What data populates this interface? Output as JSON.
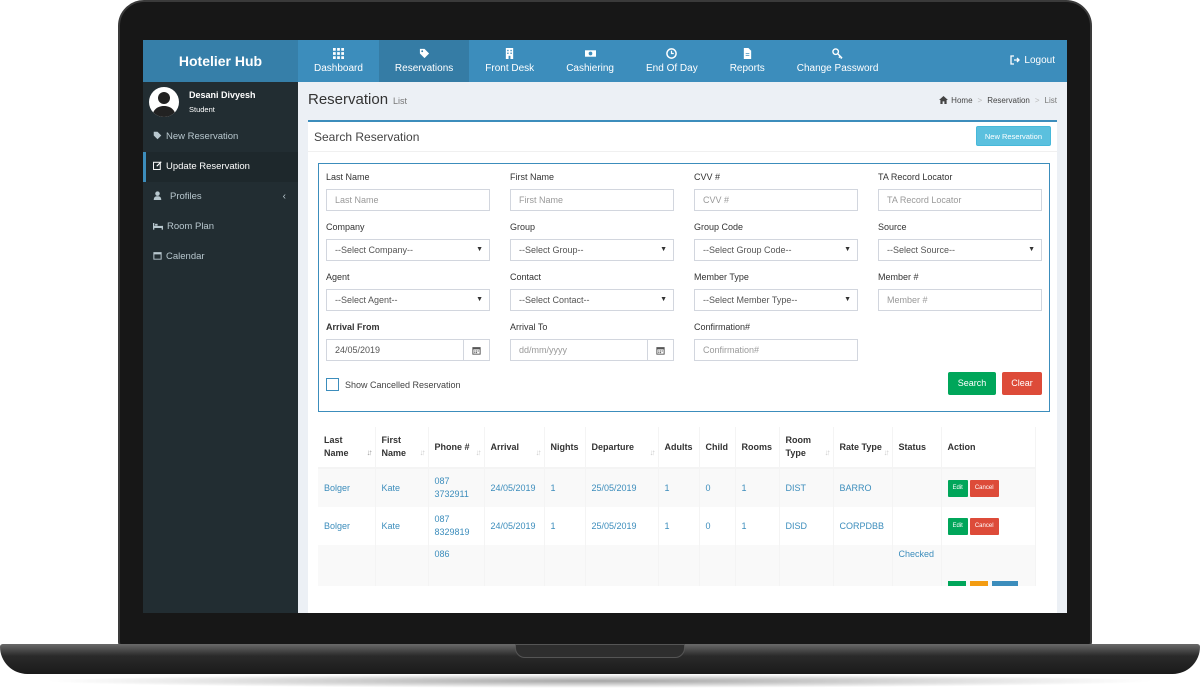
{
  "app": {
    "brand": "Hotelier Hub",
    "logout_label": "Logout"
  },
  "nav": {
    "items": [
      {
        "label": "Dashboard",
        "icon": "grid-icon"
      },
      {
        "label": "Reservations",
        "icon": "tag-icon"
      },
      {
        "label": "Front Desk",
        "icon": "building-icon"
      },
      {
        "label": "Cashiering",
        "icon": "money-icon"
      },
      {
        "label": "End Of Day",
        "icon": "clock-icon"
      },
      {
        "label": "Reports",
        "icon": "file-icon"
      },
      {
        "label": "Change Password",
        "icon": "key-icon"
      }
    ],
    "active": "Reservations"
  },
  "user": {
    "name": "Desani Divyesh",
    "role": "Student"
  },
  "sidebar": {
    "items": [
      {
        "label": "New Reservation",
        "icon": "tag-icon"
      },
      {
        "label": "Update Reservation",
        "icon": "edit-icon"
      },
      {
        "label": "Profiles",
        "icon": "user-icon"
      },
      {
        "label": "Room Plan",
        "icon": "bed-icon"
      },
      {
        "label": "Calendar",
        "icon": "calendar-icon"
      }
    ],
    "active": "Update Reservation"
  },
  "page": {
    "title": "Reservation",
    "subtitle": "List",
    "breadcrumb": [
      "Home",
      "Reservation",
      "List"
    ]
  },
  "search": {
    "title": "Search Reservation",
    "new_button": "New Reservation",
    "fields": {
      "last_name": {
        "label": "Last Name",
        "placeholder": "Last Name"
      },
      "first_name": {
        "label": "First Name",
        "placeholder": "First Name"
      },
      "cvv": {
        "label": "CVV #",
        "placeholder": "CVV #"
      },
      "ta_locator": {
        "label": "TA Record Locator",
        "placeholder": "TA Record Locator"
      },
      "company": {
        "label": "Company",
        "value": "--Select Company--"
      },
      "group": {
        "label": "Group",
        "value": "--Select Group--"
      },
      "group_code": {
        "label": "Group Code",
        "value": "--Select Group Code--"
      },
      "source": {
        "label": "Source",
        "value": "--Select Source--"
      },
      "agent": {
        "label": "Agent",
        "value": "--Select Agent--"
      },
      "contact": {
        "label": "Contact",
        "value": "--Select Contact--"
      },
      "member_type": {
        "label": "Member Type",
        "value": "--Select Member Type--"
      },
      "member_no": {
        "label": "Member #",
        "placeholder": "Member #"
      },
      "arrival_from": {
        "label": "Arrival From",
        "value": "24/05/2019"
      },
      "arrival_to": {
        "label": "Arrival To",
        "placeholder": "dd/mm/yyyy"
      },
      "confirmation": {
        "label": "Confirmation#",
        "placeholder": "Confirmation#"
      }
    },
    "show_cancelled_label": "Show Cancelled Reservation",
    "show_cancelled_checked": false,
    "search_button": "Search",
    "clear_button": "Clear"
  },
  "table": {
    "columns": [
      "Last Name",
      "First Name",
      "Phone #",
      "Arrival",
      "Nights",
      "Departure",
      "Adults",
      "Child",
      "Rooms",
      "Room Type",
      "Rate Type",
      "Status",
      "Action"
    ],
    "rows": [
      {
        "last": "Bolger",
        "first": "Kate",
        "phone": "087 3732911",
        "arrival": "24/05/2019",
        "nights": "1",
        "departure": "25/05/2019",
        "adults": "1",
        "child": "0",
        "rooms": "1",
        "room_type": "DIST",
        "rate_type": "BARRO",
        "status": "",
        "edit": "Edit",
        "cancel": "Cancel"
      },
      {
        "last": "Bolger",
        "first": "Kate",
        "phone": "087 8329819",
        "arrival": "24/05/2019",
        "nights": "1",
        "departure": "25/05/2019",
        "adults": "1",
        "child": "0",
        "rooms": "1",
        "room_type": "DISD",
        "rate_type": "CORPDBB",
        "status": "",
        "edit": "Edit",
        "cancel": "Cancel"
      },
      {
        "phone": "086",
        "status": "Checked"
      }
    ]
  },
  "colors": {
    "primary": "#3c8dbc",
    "sidebar": "#222d32",
    "success": "#00a65a",
    "danger": "#dd4b39",
    "info": "#5bc0de"
  }
}
